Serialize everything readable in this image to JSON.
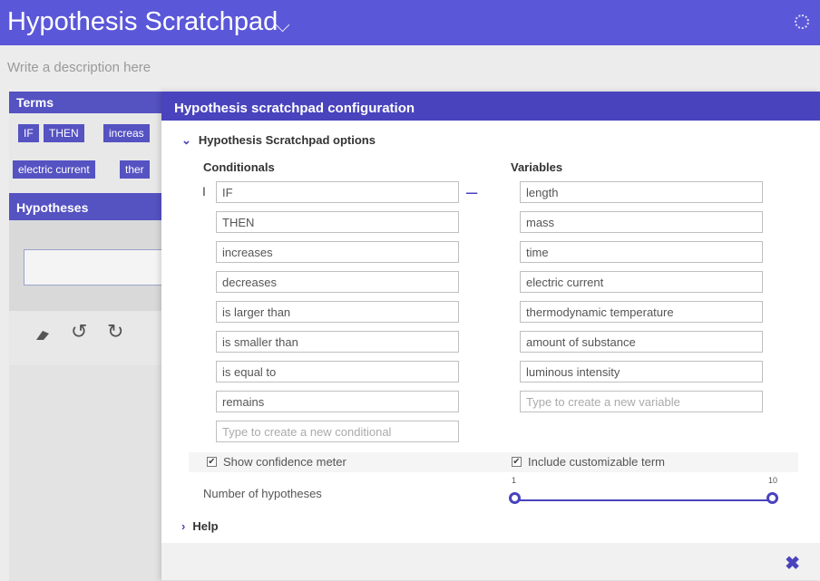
{
  "app": {
    "title": "Hypothesis Scratchpad",
    "description_placeholder": "Write a description here"
  },
  "terms": {
    "heading": "Terms",
    "chips_row1": [
      "IF",
      "THEN",
      "increas"
    ],
    "chips_row2": [
      "electric current",
      "ther"
    ]
  },
  "hypotheses": {
    "heading": "Hypotheses"
  },
  "toolbar_icons": [
    "eraser-icon",
    "undo-icon",
    "redo-icon"
  ],
  "modal": {
    "title": "Hypothesis scratchpad configuration",
    "section_title": "Hypothesis Scratchpad options",
    "conditionals_heading": "Conditionals",
    "variables_heading": "Variables",
    "conditionals": [
      "IF",
      "THEN",
      "increases",
      "decreases",
      "is larger than",
      "is smaller than",
      "is equal to",
      "remains"
    ],
    "conditional_placeholder": "Type to create a new conditional",
    "variables": [
      "length",
      "mass",
      "time",
      "electric current",
      "thermodynamic temperature",
      "amount of substance",
      "luminous intensity"
    ],
    "variable_placeholder": "Type to create a new variable",
    "show_confidence_label": "Show confidence meter",
    "show_confidence_checked": true,
    "include_term_label": "Include customizable term",
    "include_term_checked": true,
    "num_hypotheses_label": "Number of hypotheses",
    "slider": {
      "min_label": "1",
      "max_label": "10"
    },
    "help_label": "Help",
    "remove_symbol": "–",
    "close_symbol": "✖"
  },
  "colors": {
    "accent": "#4943bd",
    "topbar": "#5b57d9"
  }
}
